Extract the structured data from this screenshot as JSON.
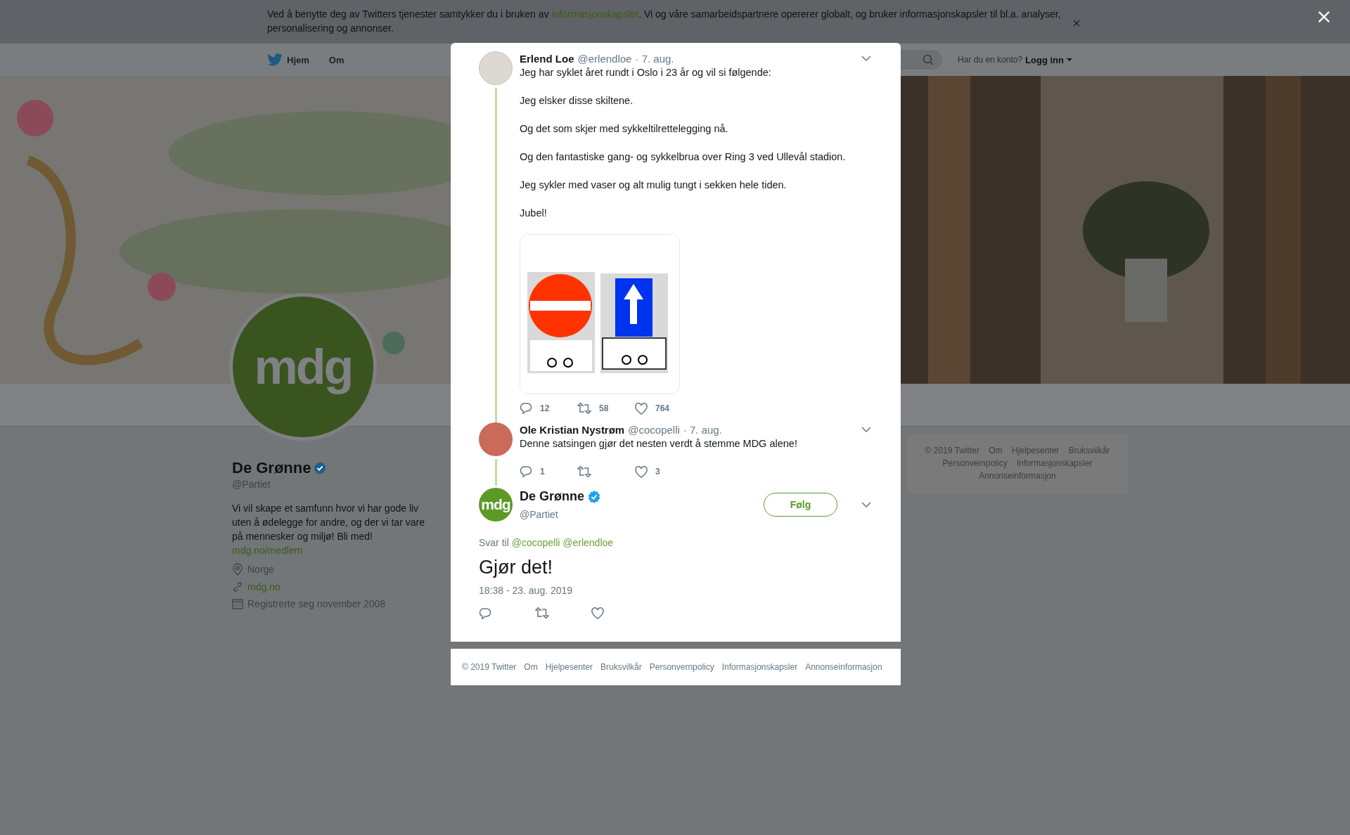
{
  "cookie_banner": {
    "text_before": "Ved å benytte deg av Twitters tjenester samtykker du i bruken av ",
    "link": "informasjonskapsler",
    "text_after": ". Vi og våre samarbeidspartnere opererer globalt, og bruker informasjonskapsler til bl.a. analyser, personalisering og annonser."
  },
  "nav": {
    "items": [
      {
        "label": "Hjem",
        "kind": "home"
      },
      {
        "label": "Om",
        "kind": "plain"
      }
    ],
    "login_prompt": "Har du en konto?",
    "login_link": "Logg inn"
  },
  "banner": {
    "kind": "picture"
  },
  "profile": {
    "avatar_text": "mdg",
    "name": "De Grønne",
    "verified": true,
    "handle": "@Partiet",
    "bio": "Vi vil skape et samfunn hvor vi har gode liv uten å ødelegge for andre, og der vi tar vare på mennesker og miljø! Bli med!",
    "bio_link": "mdg.no/medlem",
    "details": [
      {
        "kind": "location",
        "text": "Norge",
        "link": false
      },
      {
        "kind": "website",
        "text": "mdg.no",
        "link": true
      },
      {
        "kind": "joined",
        "text": "Registrerte seg november 2008",
        "link": false
      }
    ]
  },
  "sidebar_footer": {
    "links": [
      "© 2019 Twitter",
      "Om",
      "Hjelpesenter",
      "Bruksvilkår",
      "Personvernpolicy",
      "Informasjonskapsler",
      "Annonseinformasjon"
    ]
  },
  "modal": {
    "thread": [
      {
        "kind": "sketch",
        "name": "Erlend Loe",
        "handle": "@erlendloe",
        "date": "· 7. aug.",
        "paragraphs": [
          "Jeg har syklet året rundt i Oslo i 23 år og vil si følgende:",
          "Jeg elsker disse skiltene.",
          "Og det som skjer med sykkeltilrettelegging nå.",
          "Og den fantastiske gang- og sykkelbrua over Ring 3 ved Ullevål stadion.",
          "Jeg sykler med vaser og alt mulig tungt i sekken hele tiden.",
          "Jubel!"
        ],
        "media": {
          "kind": "picture"
        },
        "replies": "12",
        "retweets": "58",
        "likes": "764"
      },
      {
        "name": "Ole Kristian Nystrøm",
        "handle": "@cocopelli",
        "date": "· 7. aug.",
        "paragraphs": [
          "Denne satsingen gjør det nesten verdt å stemme MDG alene!"
        ],
        "replies": "1",
        "likes": "3"
      }
    ],
    "focused": {
      "avatar_text": "mdg",
      "name": "De Grønne",
      "verified": true,
      "handle": "@Partiet",
      "follow": "Følg",
      "reply_label": "Svar til",
      "mentions": [
        "@cocopelli",
        "@erlendloe"
      ],
      "text": "Gjør det!",
      "timestamp": "18:38 - 23. aug. 2019"
    },
    "footer": {
      "links": [
        "© 2019 Twitter",
        "Om",
        "Hjelpesenter",
        "Bruksvilkår",
        "Personvernpolicy",
        "Informasjonskapsler",
        "Annonseinformasjon"
      ]
    }
  }
}
